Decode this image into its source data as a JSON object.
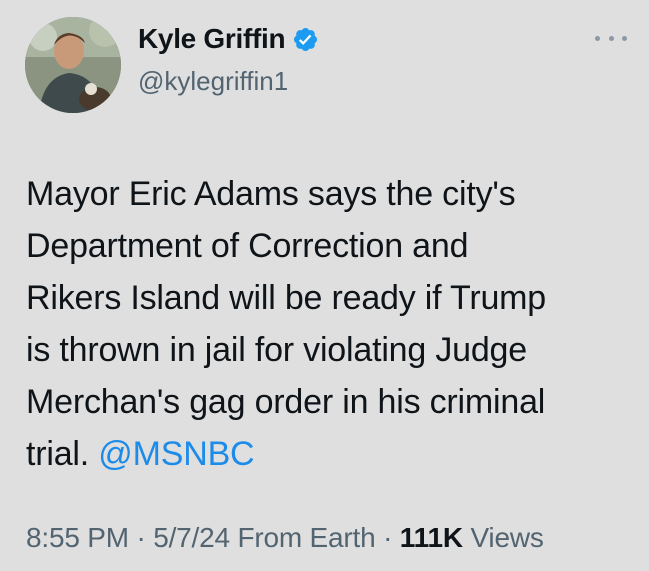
{
  "author": {
    "display_name": "Kyle Griffin",
    "handle": "@kylegriffin1",
    "verified": true,
    "verified_color": "#1d9bf0"
  },
  "tweet": {
    "lines": [
      "Mayor Eric Adams says the city's",
      "Department of Correction and",
      "Rikers Island will be ready if Trump",
      "is thrown in jail for violating Judge",
      "Merchan's gag order in his criminal",
      "trial."
    ],
    "mention": "@MSNBC",
    "mention_color": "#1d8be8"
  },
  "meta": {
    "time": "8:55 PM",
    "date": "5/7/24",
    "source": "From Earth",
    "separator": "·",
    "views_count": "111K",
    "views_label": "Views"
  },
  "icons": {
    "more": "more-dots-icon",
    "verified": "verified-badge-icon"
  },
  "colors": {
    "background": "#dfdfe0",
    "text": "#0f1419",
    "secondary": "#536471"
  }
}
